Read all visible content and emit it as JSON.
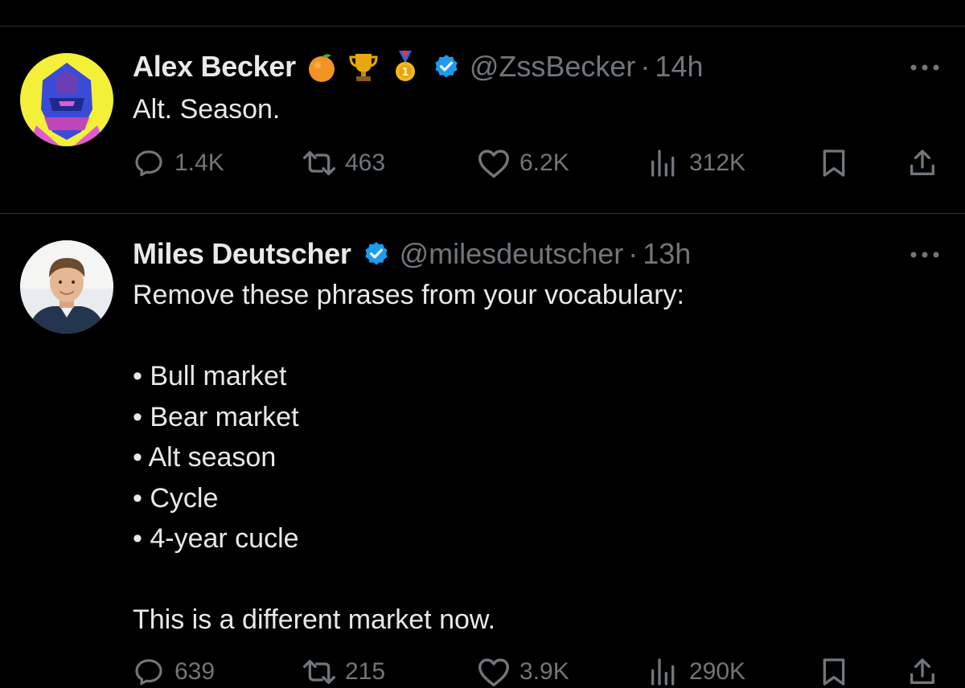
{
  "tweets": [
    {
      "author_name": "Alex Becker",
      "badges": [
        "orange-emoji",
        "trophy-emoji",
        "medal-emoji"
      ],
      "verified": true,
      "handle": "@ZssBecker",
      "separator": "·",
      "time": "14h",
      "text_lines": [
        "Alt. Season."
      ],
      "actions": {
        "replies": "1.4K",
        "reposts": "463",
        "likes": "6.2K",
        "views": "312K"
      }
    },
    {
      "author_name": "Miles Deutscher",
      "verified": true,
      "handle": "@milesdeutscher",
      "separator": "·",
      "time": "13h",
      "text_lines": [
        "Remove these phrases from your vocabulary:",
        "",
        "• Bull market",
        "• Bear market",
        "• Alt season",
        "• Cycle",
        "• 4-year cucle",
        "",
        "This is a different market now."
      ],
      "actions": {
        "replies": "639",
        "reposts": "215",
        "likes": "3.9K",
        "views": "290K"
      }
    }
  ],
  "colors": {
    "background": "#000000",
    "text": "#e7e9ea",
    "secondary": "#71767b",
    "divider": "#2f3336",
    "verified": "#1d9bf0"
  }
}
